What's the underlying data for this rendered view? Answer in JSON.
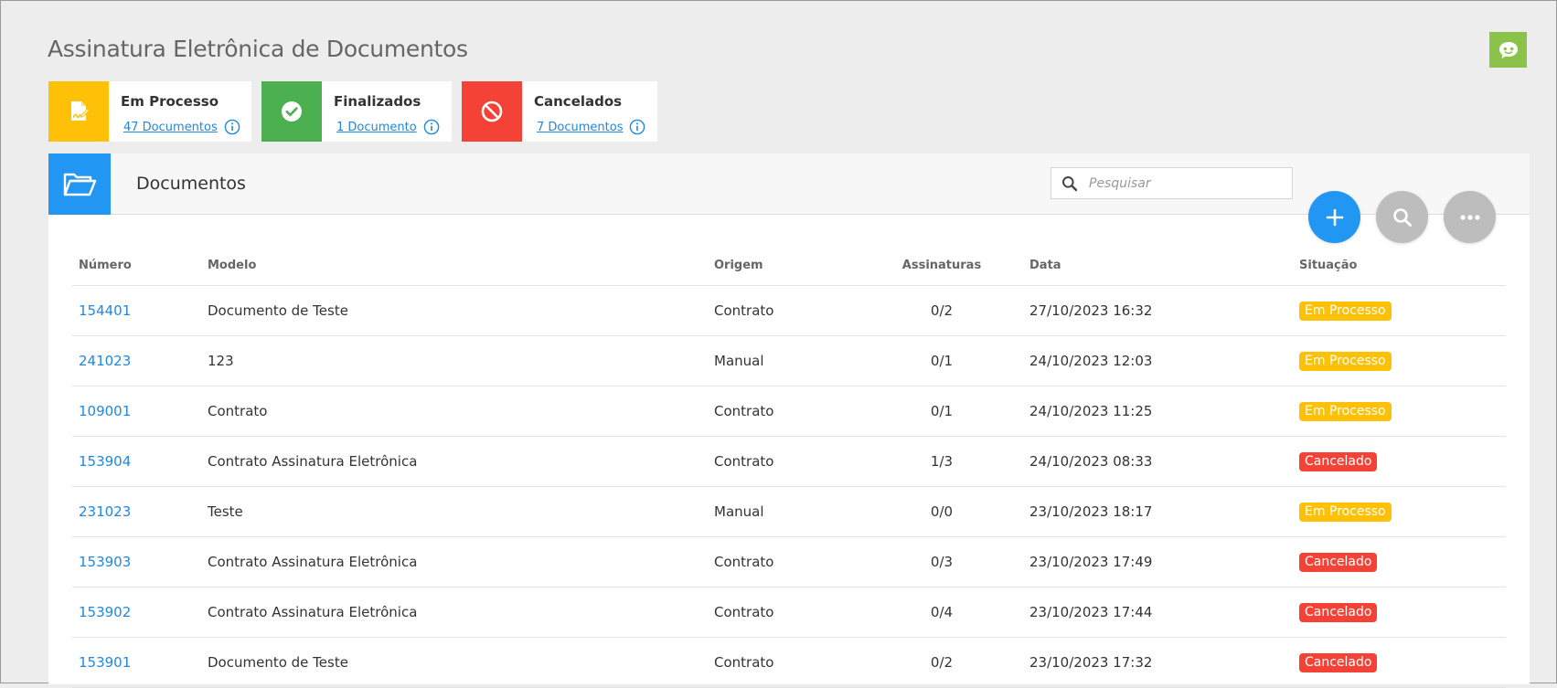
{
  "page": {
    "title": "Assinatura Eletrônica de Documentos",
    "help_icon": "chat-bot-icon",
    "accent": "#8bc34a"
  },
  "summary_cards": [
    {
      "label": "Em Processo",
      "link": "47 Documentos",
      "color": "#ffc107",
      "icon": "document-signature-icon"
    },
    {
      "label": "Finalizados",
      "link": "1 Documento",
      "color": "#4caf50",
      "icon": "check-circle-icon"
    },
    {
      "label": "Cancelados",
      "link": "7 Documentos",
      "color": "#f44336",
      "icon": "block-icon"
    }
  ],
  "panel": {
    "title": "Documentos",
    "search_placeholder": "Pesquisar",
    "folder_icon": "folder-open-icon",
    "actions": [
      "add-icon",
      "search-icon",
      "more-icon"
    ]
  },
  "table": {
    "headers": [
      "Número",
      "Modelo",
      "Origem",
      "Assinaturas",
      "Data",
      "Situação"
    ],
    "rows": [
      {
        "numero": "154401",
        "modelo": "Documento de Teste",
        "origem": "Contrato",
        "assinaturas": "0/2",
        "data": "27/10/2023 16:32",
        "situacao": "Em Processo"
      },
      {
        "numero": "241023",
        "modelo": "123",
        "origem": "Manual",
        "assinaturas": "0/1",
        "data": "24/10/2023 12:03",
        "situacao": "Em Processo"
      },
      {
        "numero": "109001",
        "modelo": "Contrato",
        "origem": "Contrato",
        "assinaturas": "0/1",
        "data": "24/10/2023 11:25",
        "situacao": "Em Processo"
      },
      {
        "numero": "153904",
        "modelo": "Contrato Assinatura Eletrônica",
        "origem": "Contrato",
        "assinaturas": "1/3",
        "data": "24/10/2023 08:33",
        "situacao": "Cancelado"
      },
      {
        "numero": "231023",
        "modelo": "Teste",
        "origem": "Manual",
        "assinaturas": "0/0",
        "data": "23/10/2023 18:17",
        "situacao": "Em Processo"
      },
      {
        "numero": "153903",
        "modelo": "Contrato Assinatura Eletrônica",
        "origem": "Contrato",
        "assinaturas": "0/3",
        "data": "23/10/2023 17:49",
        "situacao": "Cancelado"
      },
      {
        "numero": "153902",
        "modelo": "Contrato Assinatura Eletrônica",
        "origem": "Contrato",
        "assinaturas": "0/4",
        "data": "23/10/2023 17:44",
        "situacao": "Cancelado"
      },
      {
        "numero": "153901",
        "modelo": "Documento de Teste",
        "origem": "Contrato",
        "assinaturas": "0/2",
        "data": "23/10/2023 17:32",
        "situacao": "Cancelado"
      }
    ]
  },
  "status_colors": {
    "Em Processo": "#ffc107",
    "Cancelado": "#f44336"
  }
}
